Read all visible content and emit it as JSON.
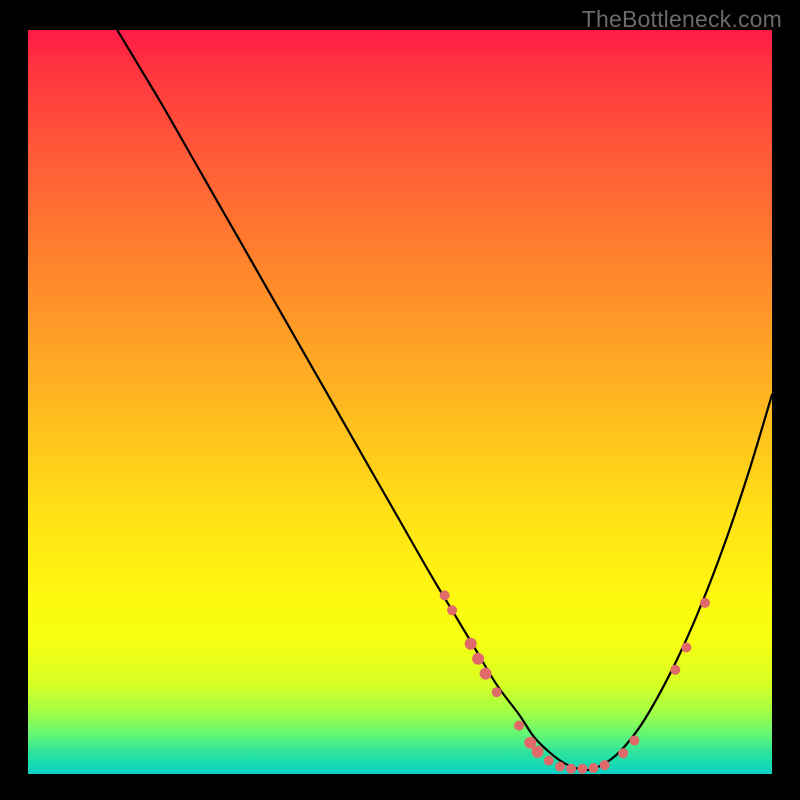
{
  "watermark": "TheBottleneck.com",
  "chart_data": {
    "type": "line",
    "title": "",
    "xlabel": "",
    "ylabel": "",
    "xlim": [
      0,
      100
    ],
    "ylim": [
      0,
      100
    ],
    "series": [
      {
        "name": "curve",
        "x": [
          12,
          15,
          18,
          22,
          26,
          30,
          34,
          38,
          42,
          46,
          50,
          54,
          57,
          60,
          63,
          66,
          68,
          70,
          72,
          74,
          76,
          79,
          82,
          85,
          88,
          91,
          94,
          97,
          100
        ],
        "y": [
          100,
          95,
          90,
          83,
          76,
          69,
          62,
          55,
          48,
          41,
          34,
          27,
          22,
          17,
          12,
          8,
          5,
          3,
          1.5,
          0.7,
          0.7,
          2.5,
          6,
          11,
          17,
          24,
          32,
          41,
          51
        ]
      }
    ],
    "markers": [
      {
        "x": 56,
        "y": 24,
        "r": 5
      },
      {
        "x": 57,
        "y": 22,
        "r": 5
      },
      {
        "x": 59.5,
        "y": 17.5,
        "r": 6
      },
      {
        "x": 60.5,
        "y": 15.5,
        "r": 6
      },
      {
        "x": 61.5,
        "y": 13.5,
        "r": 6
      },
      {
        "x": 63,
        "y": 11,
        "r": 5
      },
      {
        "x": 66,
        "y": 6.5,
        "r": 5
      },
      {
        "x": 67.5,
        "y": 4.2,
        "r": 6
      },
      {
        "x": 68.5,
        "y": 3.0,
        "r": 6
      },
      {
        "x": 70,
        "y": 1.8,
        "r": 5
      },
      {
        "x": 71.5,
        "y": 1.0,
        "r": 5
      },
      {
        "x": 73,
        "y": 0.7,
        "r": 5
      },
      {
        "x": 74.5,
        "y": 0.7,
        "r": 5
      },
      {
        "x": 76,
        "y": 0.8,
        "r": 5
      },
      {
        "x": 77.5,
        "y": 1.2,
        "r": 5
      },
      {
        "x": 80,
        "y": 2.8,
        "r": 5
      },
      {
        "x": 81.5,
        "y": 4.5,
        "r": 5
      },
      {
        "x": 87,
        "y": 14,
        "r": 5
      },
      {
        "x": 88.5,
        "y": 17,
        "r": 5
      },
      {
        "x": 91,
        "y": 23,
        "r": 5
      }
    ],
    "gradient_stops": [
      {
        "pct": 0,
        "color": "#ff1a47"
      },
      {
        "pct": 16,
        "color": "#ff5838"
      },
      {
        "pct": 40,
        "color": "#ff9b27"
      },
      {
        "pct": 64,
        "color": "#ffde16"
      },
      {
        "pct": 82,
        "color": "#f6ff10"
      },
      {
        "pct": 92,
        "color": "#9cff4a"
      },
      {
        "pct": 100,
        "color": "#0cd0c7"
      }
    ]
  }
}
